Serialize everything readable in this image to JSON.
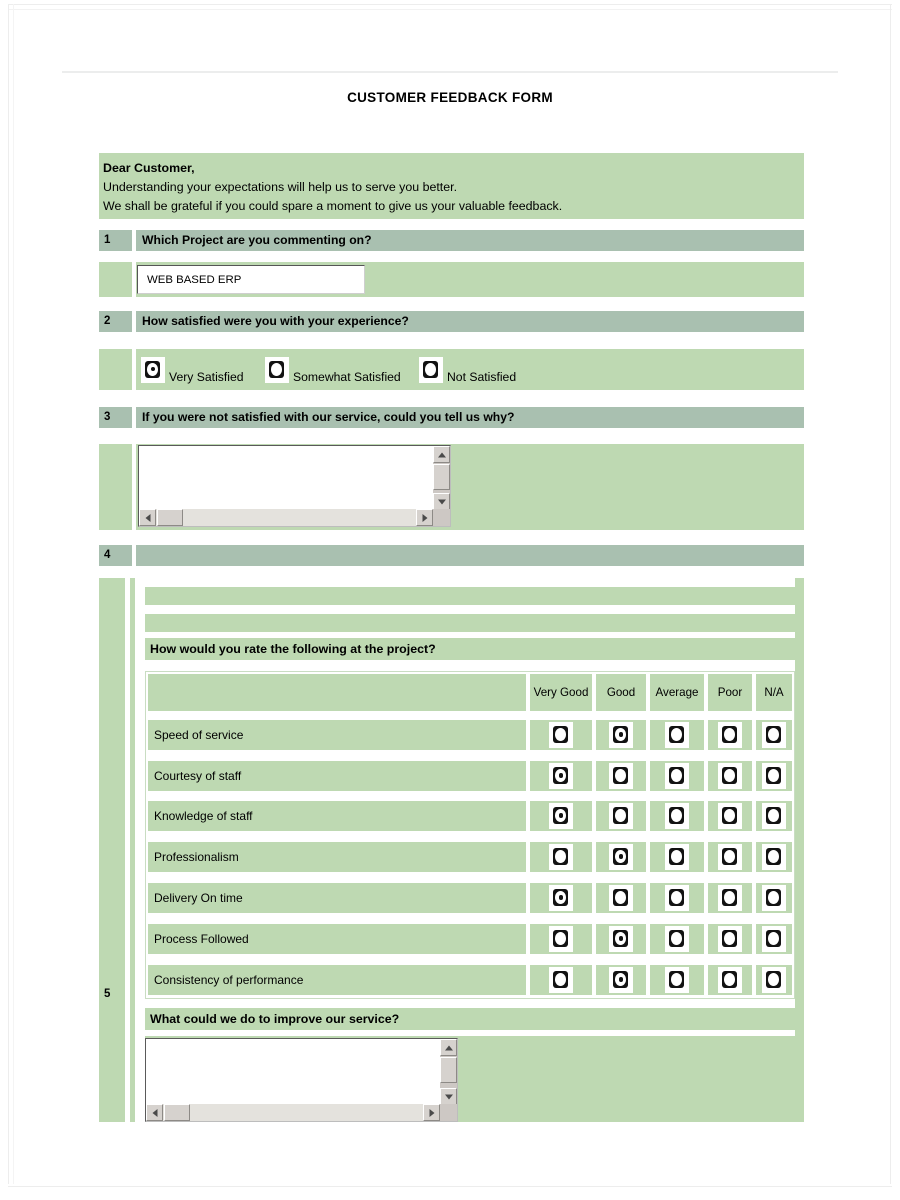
{
  "document": {
    "title": "CUSTOMER FEEDBACK FORM"
  },
  "intro": {
    "salutation": "Dear Customer,",
    "line1": "Understanding your expectations will help us to serve you better.",
    "line2": "We shall be grateful if you could spare a moment to give us your valuable feedback."
  },
  "colors": {
    "band_header": "#a9c0b0",
    "band_body": "#bed9b2",
    "page_background": "#ffffff",
    "text": "#000000"
  },
  "questions": [
    {
      "number": "1",
      "text": "Which Project are you commenting on?",
      "answer_value": "WEB BASED ERP",
      "answer_placeholder": ""
    },
    {
      "number": "2",
      "text": "How satisfied were you with your experience?",
      "options": [
        {
          "label": "Very Satisfied",
          "selected": true
        },
        {
          "label": "Somewhat Satisfied",
          "selected": false
        },
        {
          "label": "Not Satisfied",
          "selected": false
        }
      ]
    },
    {
      "number": "3",
      "text": "If you were not satisfied with our service, could you tell us why?",
      "answer_value": "",
      "answer_placeholder": ""
    },
    {
      "number": "4",
      "text": ""
    },
    {
      "number": "5",
      "text": ""
    }
  ],
  "rating_section": {
    "title": "How would you rate the following at the project?",
    "columns": [
      "Very Good",
      "Good",
      "Average",
      "Poor",
      "N/A"
    ],
    "rows": [
      {
        "label": "Speed of service",
        "selected_index": 1
      },
      {
        "label": "Courtesy of staff",
        "selected_index": 0
      },
      {
        "label": "Knowledge of staff",
        "selected_index": 0
      },
      {
        "label": "Professionalism",
        "selected_index": 1
      },
      {
        "label": "Delivery On time",
        "selected_index": 0
      },
      {
        "label": "Process Followed",
        "selected_index": 1
      },
      {
        "label": "Consistency of performance",
        "selected_index": 1
      }
    ]
  },
  "improve_section": {
    "title": "What could we do to improve our service?",
    "answer_value": "",
    "answer_placeholder": ""
  }
}
